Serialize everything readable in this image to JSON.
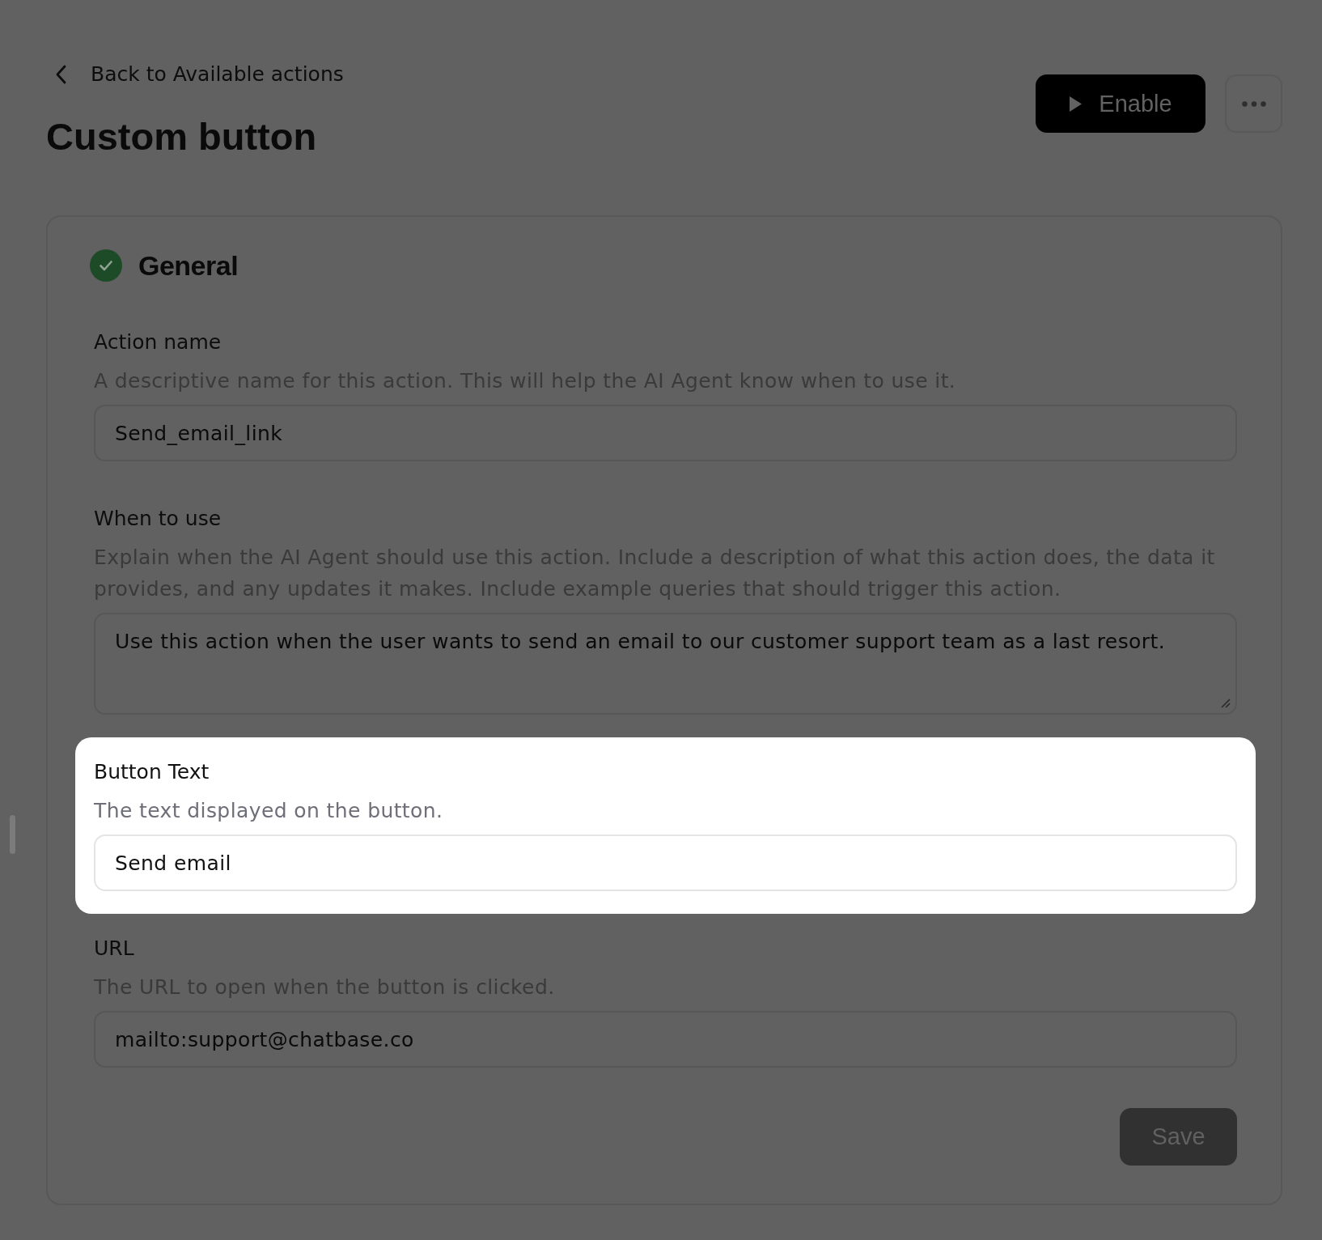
{
  "back_link": {
    "label": "Back to Available actions"
  },
  "title": "Custom button",
  "enable_button": {
    "label": "Enable"
  },
  "section": {
    "title": "General",
    "completed": true,
    "fields": [
      {
        "kind": "input",
        "label": "Action name",
        "description": "A descriptive name for this action. This will help the AI Agent know when to use it.",
        "value": "Send_email_link",
        "highlighted": false
      },
      {
        "kind": "textarea",
        "label": "When to use",
        "description": "Explain when the AI Agent should use this action. Include a description of what this action does, the data it provides, and any updates it makes. Include example queries that should trigger this action.",
        "value": "Use this action when the user wants to send an email to our customer support team as a last resort.",
        "highlighted": false
      },
      {
        "kind": "input",
        "label": "Button Text",
        "description": "The text displayed on the button.",
        "value": "Send email",
        "highlighted": true
      },
      {
        "kind": "input",
        "label": "URL",
        "description": "The URL to open when the button is clicked.",
        "value": "mailto:support@chatbase.co",
        "highlighted": false
      }
    ],
    "save_button": {
      "label": "Save",
      "disabled": true
    }
  }
}
